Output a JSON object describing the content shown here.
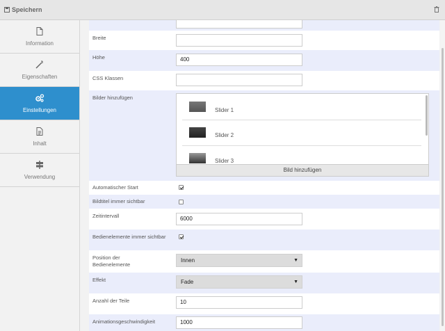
{
  "toolbar": {
    "save_label": "Speichern"
  },
  "sidebar": {
    "items": [
      {
        "label": "Information",
        "icon": "file-icon"
      },
      {
        "label": "Eigenschaften",
        "icon": "wand-icon"
      },
      {
        "label": "Einstellungen",
        "icon": "gears-icon",
        "active": true
      },
      {
        "label": "Inhalt",
        "icon": "document-icon"
      },
      {
        "label": "Verwendung",
        "icon": "signpost-icon"
      }
    ]
  },
  "form": {
    "breite": {
      "label": "Breite",
      "value": ""
    },
    "hoehe": {
      "label": "Höhe",
      "value": "400"
    },
    "css": {
      "label": "CSS Klassen",
      "value": ""
    },
    "bilder": {
      "label": "Bilder hinzufügen",
      "slides": [
        "Slider 1",
        "Slider 2",
        "Slider 3"
      ],
      "add_label": "Bild hinzufügen"
    },
    "autostart": {
      "label": "Automatischer Start",
      "checked": true
    },
    "bildtitel": {
      "label": "Bildtitel immer sichtbar",
      "checked": false
    },
    "zeitintervall": {
      "label": "Zeitintervall",
      "value": "6000"
    },
    "bedien": {
      "label": "Bedienelemente immer sichtbar",
      "checked": true
    },
    "position": {
      "label": "Position der Bedienelemente",
      "value": "Innen"
    },
    "effekt": {
      "label": "Effekt",
      "value": "Fade"
    },
    "teile": {
      "label": "Anzahl der Teile",
      "value": "10"
    },
    "speed": {
      "label": "Animationsgeschwindigkeit",
      "value": "1000"
    }
  },
  "colors": {
    "accent": "#2e8fcd",
    "row_alt": "#eaedfb"
  }
}
